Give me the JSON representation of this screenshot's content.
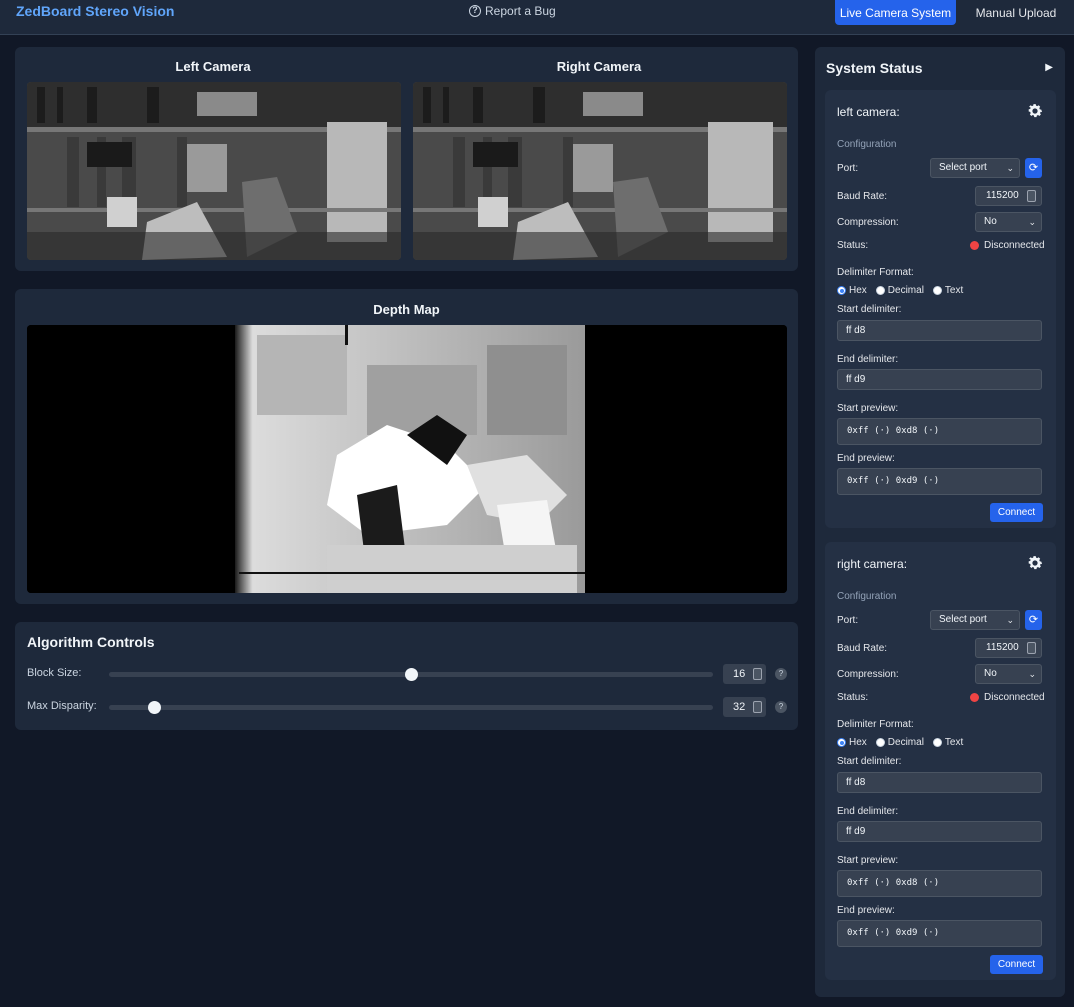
{
  "header": {
    "brand": "ZedBoard Stereo Vision",
    "report_bug": "Report a Bug",
    "tabs": [
      {
        "label": "Live Camera System",
        "active": true
      },
      {
        "label": "Manual Upload",
        "active": false
      }
    ]
  },
  "cameras": {
    "left_title": "Left Camera",
    "right_title": "Right Camera"
  },
  "depth": {
    "title": "Depth Map"
  },
  "algorithm": {
    "title": "Algorithm Controls",
    "controls": [
      {
        "label": "Block Size:",
        "value": "16",
        "fraction": 0.5
      },
      {
        "label": "Max Disparity:",
        "value": "32",
        "fraction": 0.075
      }
    ],
    "help": "?"
  },
  "status": {
    "title": "System Status",
    "cards": [
      {
        "title": "left camera:",
        "config": "Configuration",
        "port_label": "Port:",
        "port_value": "Select port",
        "baud_label": "Baud Rate:",
        "baud_value": "115200",
        "compression_label": "Compression:",
        "compression_value": "No",
        "status_label": "Status:",
        "status_value": "Disconnected",
        "delimiter_label": "Delimiter Format:",
        "formats": [
          "Hex",
          "Decimal",
          "Text"
        ],
        "selected_format": "Hex",
        "start_label": "Start delimiter:",
        "start_value": "ff d8",
        "end_label": "End delimiter:",
        "end_value": "ff d9",
        "start_preview_label": "Start preview:",
        "start_preview": "0xff (·) 0xd8 (·)",
        "end_preview_label": "End preview:",
        "end_preview": "0xff (·) 0xd9 (·)",
        "connect": "Connect"
      },
      {
        "title": "right camera:",
        "config": "Configuration",
        "port_label": "Port:",
        "port_value": "Select port",
        "baud_label": "Baud Rate:",
        "baud_value": "115200",
        "compression_label": "Compression:",
        "compression_value": "No",
        "status_label": "Status:",
        "status_value": "Disconnected",
        "delimiter_label": "Delimiter Format:",
        "formats": [
          "Hex",
          "Decimal",
          "Text"
        ],
        "selected_format": "Hex",
        "start_label": "Start delimiter:",
        "start_value": "ff d8",
        "end_label": "End delimiter:",
        "end_value": "ff d9",
        "start_preview_label": "Start preview:",
        "start_preview": "0xff (·) 0xd8 (·)",
        "end_preview_label": "End preview:",
        "end_preview": "0xff (·) 0xd9 (·)",
        "connect": "Connect"
      }
    ]
  },
  "colors": {
    "accent": "#2563eb",
    "brand": "#60a5fa",
    "status_disconnected": "#ef4444"
  }
}
